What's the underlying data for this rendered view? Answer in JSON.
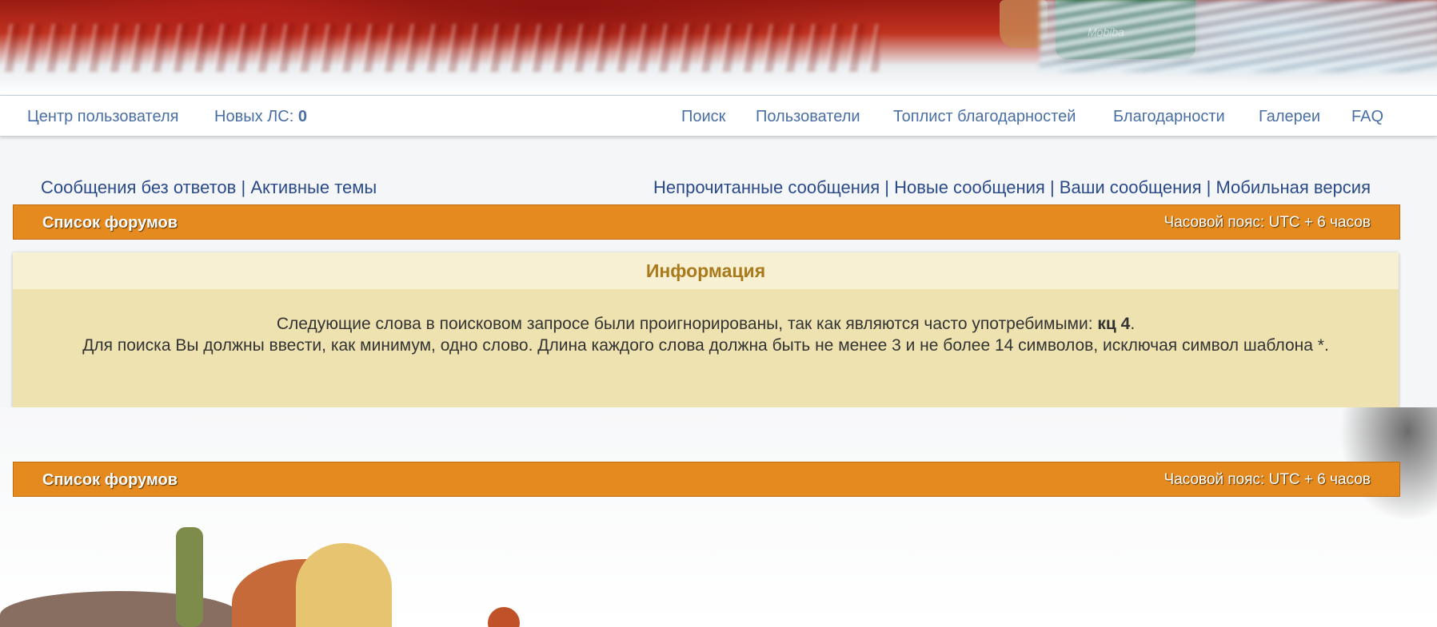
{
  "banner": {
    "brand_text": "Mobiba"
  },
  "nav": {
    "user_center": "Центр пользователя",
    "new_pm_label": "Новых ЛС:",
    "new_pm_count": "0",
    "search": "Поиск",
    "members": "Пользователи",
    "thanks_toplist": "Топлист благодарностей",
    "thanks": "Благодарности",
    "galleries": "Галереи",
    "faq": "FAQ"
  },
  "quicklinks": {
    "unanswered": "Сообщения без ответов",
    "active": "Активные темы",
    "unread": "Непрочитанные сообщения",
    "new_posts": "Новые сообщения",
    "your_posts": "Ваши сообщения",
    "mobile": "Мобильная версия",
    "separator": "|"
  },
  "breadcrumb": {
    "forum_list": "Список форумов",
    "timezone": "Часовой пояс: UTC + 6 часов"
  },
  "info": {
    "title": "Информация",
    "line1_prefix": "Следующие слова в поисковом запросе были проигнорированы, так как являются часто употребимыми:",
    "ignored_words": "кц 4",
    "line1_suffix": ".",
    "line2": "Для поиска Вы должны ввести, как минимум, одно слово. Длина каждого слова должна быть не менее 3 и не более 14 символов, исключая символ шаблона *."
  }
}
